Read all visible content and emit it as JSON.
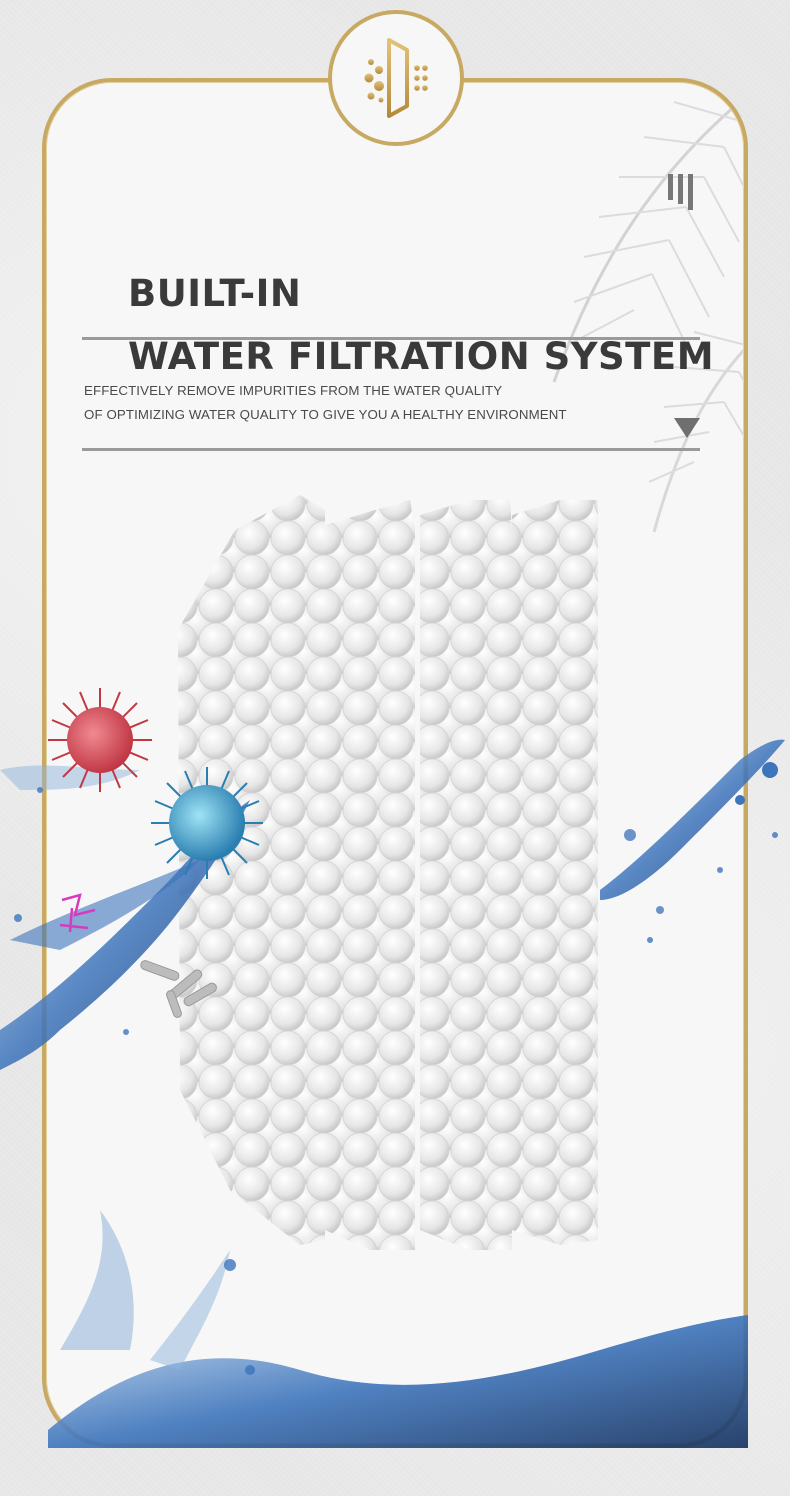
{
  "header": {
    "title_line1": "BUILT-IN",
    "title_line2": "WATER FILTRATION SYSTEM",
    "section_marker": "III"
  },
  "description": {
    "line1": "EFFECTIVELY REMOVE IMPURITIES FROM THE WATER QUALITY",
    "line2": "OF OPTIMIZING WATER QUALITY TO GIVE YOU A HEALTHY ENVIRONMENT"
  },
  "icons": {
    "badge": "filter-dots-icon",
    "marker": "roman-numeral-icon",
    "next": "triangle-down-icon",
    "decoration": [
      "palm-leaf-icon",
      "virus-icon",
      "water-splash-icon",
      "filter-beads-icon"
    ]
  },
  "colors": {
    "gold": "#c8a964",
    "title": "#3a3a3a",
    "rule": "#9a9a9a",
    "water": "#2a5fa8",
    "virus_red": "#d9535f",
    "virus_blue": "#3e9fc6",
    "virus_magenta": "#d63bbf"
  }
}
